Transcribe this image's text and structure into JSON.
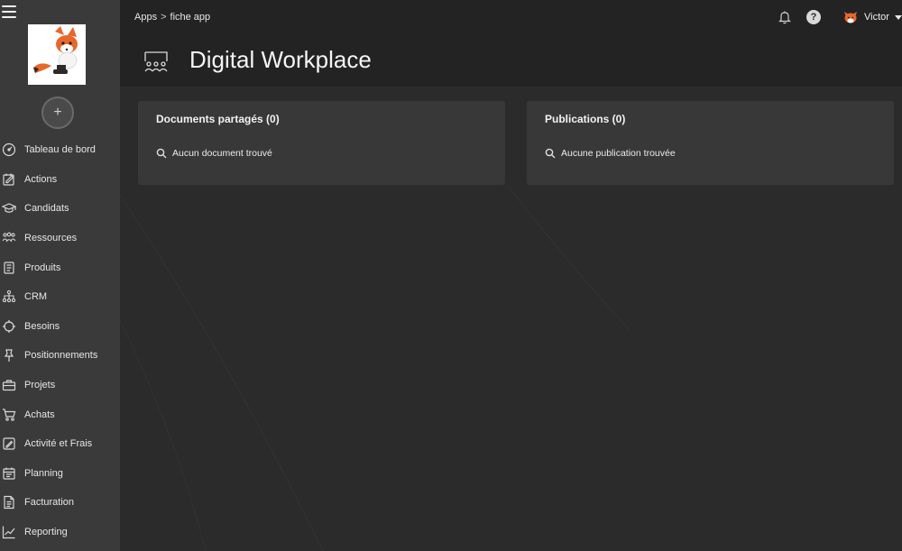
{
  "breadcrumb": {
    "root": "Apps",
    "separator": ">",
    "current": "fiche app"
  },
  "user": {
    "name": "Victor",
    "avatar_icon": "fox-avatar-icon"
  },
  "topbar": {
    "help_label": "?",
    "icons": [
      "bell-icon",
      "help-icon"
    ]
  },
  "page": {
    "title": "Digital Workplace",
    "icon": "workplace-people-icon"
  },
  "sidebar": {
    "add_label": "+",
    "items": [
      {
        "label": "Tableau de bord",
        "icon": "dashboard-gauge-icon"
      },
      {
        "label": "Actions",
        "icon": "actions-edit-icon"
      },
      {
        "label": "Candidats",
        "icon": "graduation-cap-icon"
      },
      {
        "label": "Ressources",
        "icon": "people-group-icon"
      },
      {
        "label": "Produits",
        "icon": "product-doc-icon"
      },
      {
        "label": "CRM",
        "icon": "crm-network-icon"
      },
      {
        "label": "Besoins",
        "icon": "target-icon"
      },
      {
        "label": "Positionnements",
        "icon": "pin-icon"
      },
      {
        "label": "Projets",
        "icon": "briefcase-icon"
      },
      {
        "label": "Achats",
        "icon": "cart-icon"
      },
      {
        "label": "Activité et Frais",
        "icon": "activity-edit-icon"
      },
      {
        "label": "Planning",
        "icon": "calendar-icon"
      },
      {
        "label": "Facturation",
        "icon": "invoice-icon"
      },
      {
        "label": "Reporting",
        "icon": "chart-line-icon"
      }
    ]
  },
  "cards": {
    "documents": {
      "title": "Documents partagés (0)",
      "empty": "Aucun document trouvé"
    },
    "publications": {
      "title": "Publications (0)",
      "empty": "Aucune publication trouvée"
    }
  },
  "colors": {
    "sidebar_bg": "#3a3a3a",
    "topbar_bg": "#232323",
    "main_bg": "#2b2b2b",
    "card_bg": "#383838"
  }
}
